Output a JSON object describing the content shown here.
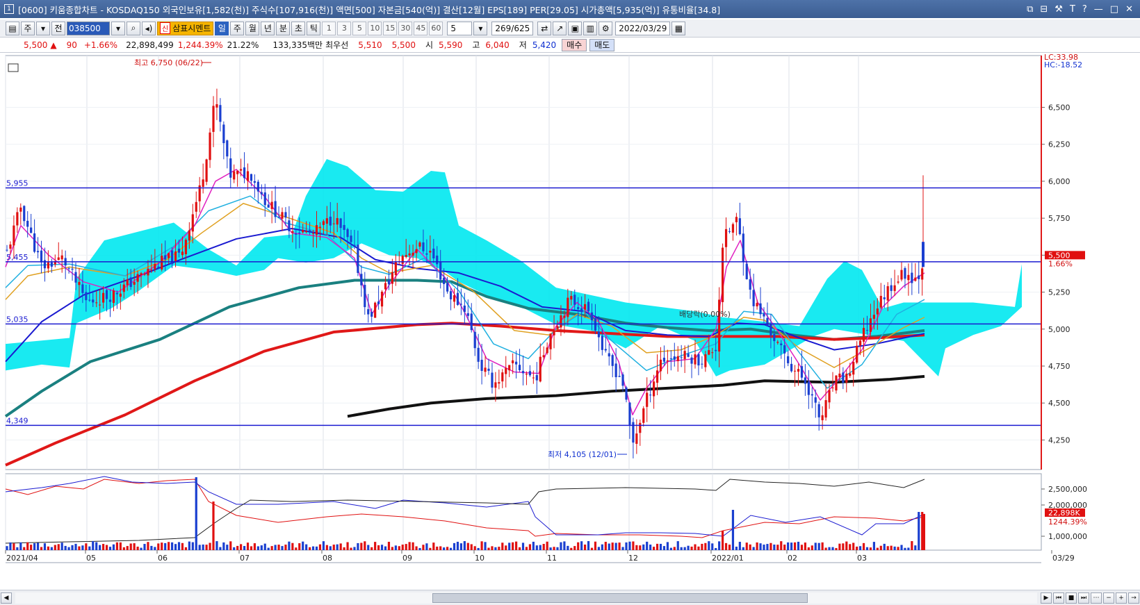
{
  "window": {
    "badge": "1",
    "title": "[0600] 키움종합차트 - KOSDAQ150 외국인보유[1,582(천)] 주식수[107,916(천)] 액면[500] 자본금[540(억)] 결산[12월] EPS[189] PER[29.05] 시가총액[5,935(억)] 유통비율[34.8]",
    "controls": [
      "⧉",
      "⊟",
      "⚒",
      "T",
      "?",
      "—",
      "□",
      "✕"
    ]
  },
  "toolbar": {
    "period_label": "주",
    "prev_label": "전",
    "code_value": "038500",
    "stock_name": "삼표시멘트",
    "stock_tag": "신",
    "periods": [
      "일",
      "주",
      "월",
      "년",
      "분",
      "초",
      "틱"
    ],
    "active_period": "일",
    "minute_values": [
      "1",
      "3",
      "5",
      "10",
      "15",
      "30",
      "45",
      "60"
    ],
    "count_value": "5",
    "range_value": "269",
    "range_total": "/625",
    "date_value": "2022/03/29"
  },
  "quote": {
    "price": "5,500",
    "arrow": "▲",
    "change": "90",
    "change_pct": "+1.66%",
    "volume": "22,898,499",
    "volume_ratio": "1,244.39%",
    "turnover": "21.22%",
    "trade_value": "133,335백만",
    "best_ask_label": "최우선",
    "best_ask": "5,510",
    "best_bid": "5,500",
    "open_label": "시",
    "open": "5,590",
    "high_label": "고",
    "high": "6,040",
    "low_label": "저",
    "low": "5,420",
    "buy_label": "매수",
    "sell_label": "매도"
  },
  "chart_data": {
    "type": "candlestick",
    "price_axis": {
      "ticks": [
        "6,500",
        "6,250",
        "6,000",
        "5,750",
        "5,500",
        "5,250",
        "5,000",
        "4,750",
        "4,500",
        "4,250"
      ],
      "range": [
        4050,
        6850
      ]
    },
    "volume_axis": {
      "ticks": [
        "2,500,000",
        "2,000,000",
        "1,000,000"
      ]
    },
    "x_ticks": [
      "2021/04",
      "05",
      "06",
      "07",
      "08",
      "09",
      "10",
      "11",
      "12",
      "2022/01",
      "02",
      "03",
      "03/29"
    ],
    "horizontal_lines": [
      {
        "label": "5,955",
        "value": 5955
      },
      {
        "label": "5,455",
        "value": 5455
      },
      {
        "label": "5,035",
        "value": 5035
      },
      {
        "label": "4,349",
        "value": 4349
      }
    ],
    "annotations": {
      "high": "최고 6,750 (06/22)",
      "low": "최저 4,105 (12/01)",
      "dividend": "배당락(0.00%)"
    },
    "right_labels": {
      "lc": "LC:33.98",
      "hc": "HC:-18.52",
      "price_tag": "5,500",
      "pct_tag": "1.66%",
      "volume_tag": "22,898K",
      "ratio_tag": "1244.39%"
    },
    "colors": {
      "up": "#e01010",
      "down": "#1a3fd0",
      "cloud": "#00e8f0",
      "ma_short": "#e020c0",
      "ma_mid": "#20b0e0",
      "ma_long": "#e0a020",
      "ma_blue": "#1a1ad0",
      "ma_teal": "#1a8080",
      "ma_red": "#e01818",
      "ma_black": "#111111",
      "hline": "#1a1ad0"
    }
  }
}
